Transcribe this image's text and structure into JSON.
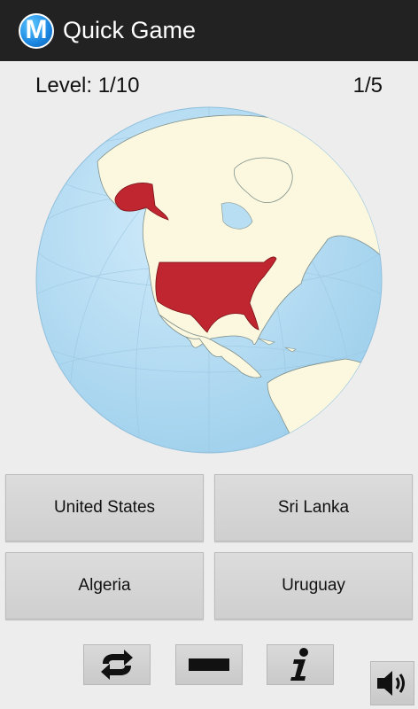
{
  "app": {
    "icon_letter": "M",
    "title": "Quick Game"
  },
  "status": {
    "level": "Level: 1/10",
    "progress": "1/5"
  },
  "globe": {
    "highlighted_country": "United States",
    "highlight_color": "#c0262f",
    "ocean_color": "#b8def3",
    "land_color": "#fbf8df"
  },
  "answers": [
    "United States",
    "Sri Lanka",
    "Algeria",
    "Uruguay"
  ],
  "toolbar": {
    "icons": [
      "repeat-icon",
      "minus-icon",
      "info-icon",
      "speaker-icon"
    ]
  }
}
